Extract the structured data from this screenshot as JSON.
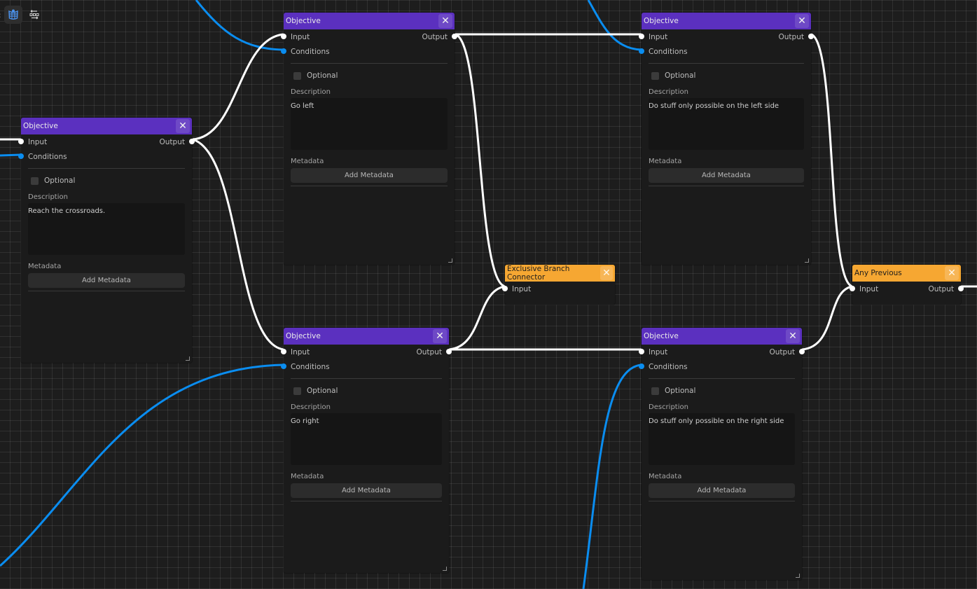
{
  "toolbar": {
    "left_edge_glyph": ":",
    "items": [
      {
        "icon": "map-grid-icon",
        "active": true
      },
      {
        "icon": "layout-arrange-icon",
        "active": false
      }
    ]
  },
  "colors": {
    "objective_header": "#5b30bf",
    "connector_header": "#f6a732",
    "flow_wire": "#ffffff",
    "condition_wire": "#0a8df0",
    "canvas": "#1d1d1d"
  },
  "nodes": [
    {
      "id": "n1",
      "type": "objective",
      "title": "Objective",
      "ports": {
        "input": "Input",
        "output": "Output",
        "conditions": "Conditions"
      },
      "optional_label": "Optional",
      "optional_checked": false,
      "description_label": "Description",
      "description": "Reach the crossroads.",
      "metadata_label": "Metadata",
      "add_metadata": "Add Metadata"
    },
    {
      "id": "n2",
      "type": "objective",
      "title": "Objective",
      "ports": {
        "input": "Input",
        "output": "Output",
        "conditions": "Conditions"
      },
      "optional_label": "Optional",
      "optional_checked": false,
      "description_label": "Description",
      "description": "Go left",
      "metadata_label": "Metadata",
      "add_metadata": "Add Metadata"
    },
    {
      "id": "n3",
      "type": "objective",
      "title": "Objective",
      "ports": {
        "input": "Input",
        "output": "Output",
        "conditions": "Conditions"
      },
      "optional_label": "Optional",
      "optional_checked": false,
      "description_label": "Description",
      "description": "Go right",
      "metadata_label": "Metadata",
      "add_metadata": "Add Metadata"
    },
    {
      "id": "n4",
      "type": "connector",
      "title": "Exclusive Branch Connector",
      "ports": {
        "input": "Input"
      }
    },
    {
      "id": "n5",
      "type": "objective",
      "title": "Objective",
      "ports": {
        "input": "Input",
        "output": "Output",
        "conditions": "Conditions"
      },
      "optional_label": "Optional",
      "optional_checked": false,
      "description_label": "Description",
      "description": "Do stuff only possible on the left side",
      "metadata_label": "Metadata",
      "add_metadata": "Add Metadata"
    },
    {
      "id": "n6",
      "type": "objective",
      "title": "Objective",
      "ports": {
        "input": "Input",
        "output": "Output",
        "conditions": "Conditions"
      },
      "optional_label": "Optional",
      "optional_checked": false,
      "description_label": "Description",
      "description": "Do stuff only possible on the right side",
      "metadata_label": "Metadata",
      "add_metadata": "Add Metadata"
    },
    {
      "id": "n7",
      "type": "connector",
      "title": "Any Previous",
      "ports": {
        "input": "Input",
        "output": "Output"
      }
    }
  ],
  "connections": [
    {
      "from": "offscreen-left",
      "to": "n1.input",
      "kind": "flow"
    },
    {
      "from": "offscreen-left",
      "to": "n1.conditions",
      "kind": "condition"
    },
    {
      "from": "n1.output",
      "to": "n2.input",
      "kind": "flow"
    },
    {
      "from": "n1.output",
      "to": "n3.input",
      "kind": "flow"
    },
    {
      "from": "offscreen-top",
      "to": "n2.conditions",
      "kind": "condition"
    },
    {
      "from": "offscreen-bottom-left",
      "to": "n3.conditions",
      "kind": "condition"
    },
    {
      "from": "n2.output",
      "to": "n4.input",
      "kind": "flow"
    },
    {
      "from": "n3.output",
      "to": "n4.input",
      "kind": "flow"
    },
    {
      "from": "n2.output",
      "to": "n5.input",
      "kind": "flow"
    },
    {
      "from": "n3.output",
      "to": "n6.input",
      "kind": "flow"
    },
    {
      "from": "offscreen-top",
      "to": "n5.conditions",
      "kind": "condition"
    },
    {
      "from": "offscreen-bottom",
      "to": "n6.conditions",
      "kind": "condition"
    },
    {
      "from": "n5.output",
      "to": "n7.input",
      "kind": "flow"
    },
    {
      "from": "n6.output",
      "to": "n7.input",
      "kind": "flow"
    },
    {
      "from": "n7.output",
      "to": "offscreen-right",
      "kind": "flow"
    }
  ]
}
